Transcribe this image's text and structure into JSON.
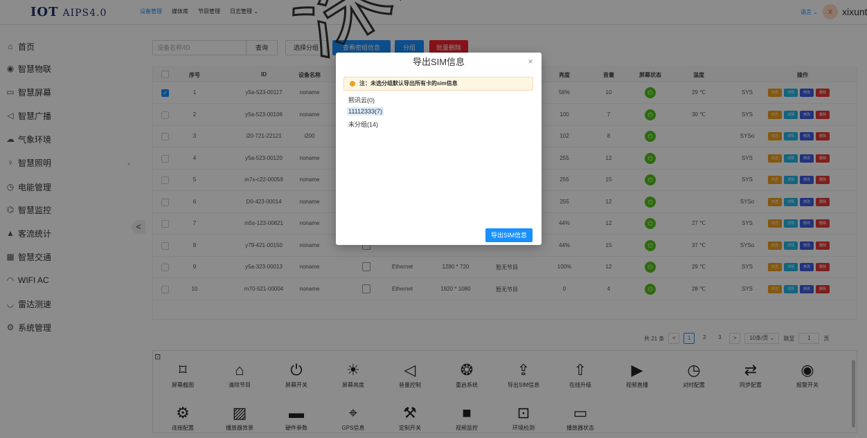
{
  "brand": {
    "logo": "IOT",
    "product": "AIPS4.0"
  },
  "topnav": [
    {
      "label": "设备管理",
      "active": true
    },
    {
      "label": "媒体库",
      "active": false
    },
    {
      "label": "节目管理",
      "active": false
    },
    {
      "label": "日志管理 ⌄",
      "active": false
    }
  ],
  "header": {
    "language": "语言 ⌄",
    "avatar_letter": "x",
    "username": "xixuntest"
  },
  "sidebar": {
    "items": [
      {
        "icon": "⌂",
        "label": "首页"
      },
      {
        "icon": "◉",
        "label": "智慧物联"
      },
      {
        "icon": "▭",
        "label": "智慧屏幕"
      },
      {
        "icon": "◁",
        "label": "智慧广播"
      },
      {
        "icon": "☁",
        "label": "气象环境"
      },
      {
        "icon": "♀",
        "label": "智慧照明",
        "chevron": "⌄"
      },
      {
        "icon": "◷",
        "label": "电能管理"
      },
      {
        "icon": "⌬",
        "label": "智慧监控"
      },
      {
        "icon": "▲",
        "label": "客流统计"
      },
      {
        "icon": "▦",
        "label": "智慧交通"
      },
      {
        "icon": "◠",
        "label": "WIFI AC"
      },
      {
        "icon": "◡",
        "label": "雷达测速"
      },
      {
        "icon": "⚙",
        "label": "系统管理"
      }
    ],
    "collapse": "<"
  },
  "toolbar": {
    "search_placeholder": "设备名称/ID",
    "query": "查询",
    "select_group": "选择分组",
    "view_group": "查看密组信息",
    "group": "分组",
    "batch_delete": "批量删除"
  },
  "table": {
    "headers": [
      "序号",
      "ID",
      "设备名称",
      "亮度",
      "音量",
      "屏幕状态",
      "温度",
      "操作"
    ],
    "op_labels": {
      "log": "日志",
      "detail": "详情",
      "edit": "修改",
      "del": "删除"
    },
    "rows": [
      {
        "no": "1",
        "id": "y5a-523-00117",
        "name": "noname",
        "net": "",
        "res": "",
        "prog": "",
        "brightness": "56%",
        "volume": "10",
        "temp": "29 ℃",
        "sys": "SYS",
        "checked": true
      },
      {
        "no": "2",
        "id": "y5a-523-00106",
        "name": "noname",
        "net": "",
        "res": "",
        "prog": "",
        "brightness": "100",
        "volume": "7",
        "temp": "30 ℃",
        "sys": "SYS",
        "checked": false
      },
      {
        "no": "3",
        "id": "i20-721-22121",
        "name": "i200",
        "net": "",
        "res": "",
        "prog": "",
        "brightness": "102",
        "volume": "8",
        "temp": "",
        "sys": "SYSo",
        "checked": false
      },
      {
        "no": "4",
        "id": "y5a-523-00120",
        "name": "noname",
        "net": "",
        "res": "",
        "prog": "",
        "brightness": "255",
        "volume": "12",
        "temp": "",
        "sys": "SYS",
        "checked": false
      },
      {
        "no": "5",
        "id": "m7s-c22-00059",
        "name": "noname",
        "net": "",
        "res": "",
        "prog": "",
        "brightness": "255",
        "volume": "15",
        "temp": "",
        "sys": "SYS",
        "checked": false
      },
      {
        "no": "6",
        "id": "D0-423-00014",
        "name": "noname",
        "net": "",
        "res": "",
        "prog": "",
        "brightness": "255",
        "volume": "12",
        "temp": "",
        "sys": "SYSo",
        "checked": false
      },
      {
        "no": "7",
        "id": "m5s-123-00821",
        "name": "noname",
        "net": "",
        "res": "",
        "prog": "",
        "brightness": "44%",
        "volume": "12",
        "temp": "27 ℃",
        "sys": "SYS",
        "checked": false
      },
      {
        "no": "8",
        "id": "y79-421-00150",
        "name": "noname",
        "net": "",
        "res": "",
        "prog": "",
        "brightness": "44%",
        "volume": "15",
        "temp": "37 ℃",
        "sys": "SYSo",
        "checked": false
      },
      {
        "no": "9",
        "id": "y5a-323-00013",
        "name": "noname",
        "net": "Ethernet",
        "res": "1280 * 720",
        "prog": "暂无节目",
        "brightness": "100%",
        "volume": "12",
        "temp": "29 ℃",
        "sys": "SYS",
        "checked": false
      },
      {
        "no": "10",
        "id": "m70-521-00004",
        "name": "noname",
        "net": "Ethernet",
        "res": "1920 * 1080",
        "prog": "暂无节目",
        "brightness": "0",
        "volume": "4",
        "temp": "28 ℃",
        "sys": "SYS",
        "checked": false
      }
    ]
  },
  "pager": {
    "total": "共 21 条",
    "prev": "<",
    "pages": [
      "1",
      "2",
      "3"
    ],
    "next": ">",
    "per_page": "10条/页 ⌄",
    "goto_label": "跳至",
    "goto_value": "1",
    "page_suffix": "页"
  },
  "actions": {
    "toggle": "⊡",
    "items": [
      {
        "icon": "⌑",
        "label": "屏幕截图"
      },
      {
        "icon": "⌂",
        "label": "清除节目"
      },
      {
        "icon": "⏻",
        "label": "屏幕开关"
      },
      {
        "icon": "☀",
        "label": "屏幕亮度"
      },
      {
        "icon": "◁",
        "label": "音量控制"
      },
      {
        "icon": "❂",
        "label": "重启系统"
      },
      {
        "icon": "⇪",
        "label": "导出SIM信息"
      },
      {
        "icon": "⇧",
        "label": "在线升级"
      },
      {
        "icon": "▶",
        "label": "视频直播"
      },
      {
        "icon": "◷",
        "label": "对时配置"
      },
      {
        "icon": "⇄",
        "label": "同步配置"
      },
      {
        "icon": "◉",
        "label": "报警开关"
      },
      {
        "icon": "⚙",
        "label": "连接配置"
      },
      {
        "icon": "▨",
        "label": "播放器背景"
      },
      {
        "icon": "▬",
        "label": "硬件参数"
      },
      {
        "icon": "⌖",
        "label": "GPS信息"
      },
      {
        "icon": "⚒",
        "label": "定制开关"
      },
      {
        "icon": "■",
        "label": "视频监控"
      },
      {
        "icon": "⊡",
        "label": "环境检测"
      },
      {
        "icon": "▭",
        "label": "播放器状态"
      }
    ]
  },
  "modal": {
    "title": "导出SIM信息",
    "close": "×",
    "notice": "注：未选分组默认导出所有卡的sim信息",
    "groups": [
      {
        "label": "熙讯云(0)",
        "selected": false
      },
      {
        "label": "11112333(7)",
        "selected": true
      },
      {
        "label": "未分组(14)",
        "selected": false
      }
    ],
    "export_button": "导出SIM信息"
  },
  "watermark": {
    "text": "深圳市熙讯云科技"
  },
  "colors": {
    "primary": "#1890ff",
    "danger": "#f5222d",
    "status_on": "#52c41a",
    "warning": "#f0a020"
  }
}
